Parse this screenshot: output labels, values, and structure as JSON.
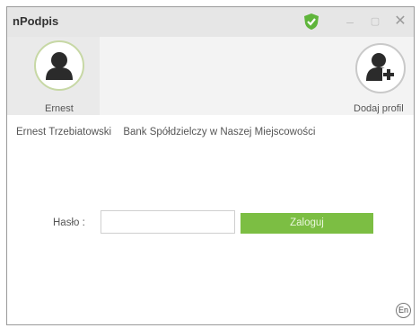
{
  "window": {
    "title": "nPodpis"
  },
  "titlebar_icons": {
    "shield": "shield-check-icon",
    "minimize": "minimize-icon",
    "maximize": "maximize-icon",
    "close": "close-icon"
  },
  "titlebar_glyphs": {
    "minimize": "–",
    "maximize": "▢",
    "close": "✕"
  },
  "profiles": [
    {
      "label": "Ernest",
      "icon": "user-icon"
    },
    {
      "label": "Dodaj profil",
      "icon": "add-user-icon"
    }
  ],
  "owner": {
    "name": "Ernest  Trzebiatowski",
    "bank": "Bank Spółdzielczy w Naszej Miejscowości"
  },
  "login": {
    "password_label": "Hasło :",
    "password_value": "",
    "submit_label": "Zaloguj"
  },
  "language": {
    "label": "En"
  },
  "colors": {
    "accent_green": "#7cbe43",
    "selected_ring": "#c7d8a5",
    "shield_green": "#5fb53b"
  }
}
